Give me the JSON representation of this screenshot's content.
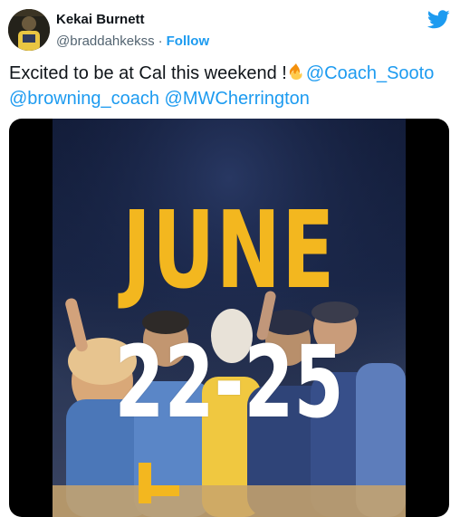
{
  "author": {
    "name": "Kekai Burnett",
    "handle": "@braddahkekss",
    "separator": "·",
    "follow_label": "Follow"
  },
  "tweet": {
    "text_before": "Excited to be at Cal this weekend !",
    "mentions": [
      "@Coach_Sooto",
      "@browning_coach",
      "@MWCherrington"
    ]
  },
  "video": {
    "month": "JUNE",
    "dates": "22-25"
  },
  "icons": {
    "brand": "twitter-bird-icon",
    "emoji": "fire-icon"
  },
  "colors": {
    "link": "#1d9bf0",
    "month_text": "#f3b71f",
    "date_text": "#ffffff"
  }
}
